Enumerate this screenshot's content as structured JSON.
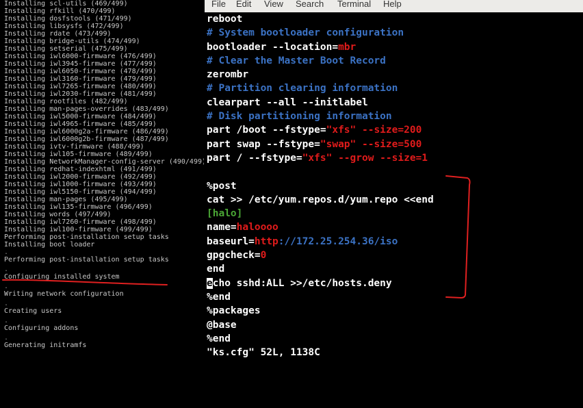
{
  "console": {
    "lines": [
      "Installing scl-utils (469/499)",
      "Installing rfkill (470/499)",
      "Installing dosfstools (471/499)",
      "Installing libsysfs (472/499)",
      "Installing rdate (473/499)",
      "Installing bridge-utils (474/499)",
      "Installing setserial (475/499)",
      "Installing iwl6000-firmware (476/499)",
      "Installing iwl3945-firmware (477/499)",
      "Installing iwl6050-firmware (478/499)",
      "Installing iwl3160-firmware (479/499)",
      "Installing iwl7265-firmware (480/499)",
      "Installing iwl2030-firmware (481/499)",
      "Installing rootfiles (482/499)",
      "Installing man-pages-overrides (483/499)",
      "Installing iwl5000-firmware (484/499)",
      "Installing iwl4965-firmware (485/499)",
      "Installing iwl6000g2a-firmware (486/499)",
      "Installing iwl6000g2b-firmware (487/499)",
      "Installing ivtv-firmware (488/499)",
      "Installing iwl105-firmware (489/499)",
      "Installing NetworkManager-config-server (490/499)",
      "Installing redhat-indexhtml (491/499)",
      "Installing iwl2000-firmware (492/499)",
      "Installing iwl1000-firmware (493/499)",
      "Installing iwl5150-firmware (494/499)",
      "Installing man-pages (495/499)",
      "Installing iwl135-firmware (496/499)",
      "Installing words (497/499)",
      "Installing iwl7260-firmware (498/499)",
      "Installing iwl100-firmware (499/499)",
      "Performing post-installation setup tasks",
      "Installing boot loader"
    ],
    "steps": [
      "Performing post-installation setup tasks",
      "Configuring installed system",
      "Writing network configuration",
      "Creating users",
      "Configuring addons",
      "Generating initramfs"
    ],
    "dot": "."
  },
  "menubar": {
    "file": "File",
    "edit": "Edit",
    "view": "View",
    "search": "Search",
    "terminal": "Terminal",
    "help": "Help"
  },
  "terminal": {
    "l1": "reboot",
    "l2": "# System bootloader configuration",
    "l3a": "bootloader --location=",
    "l3b": "mbr",
    "l4": "# Clear the Master Boot Record",
    "l5": "zerombr",
    "l6": "# Partition clearing information",
    "l7": "clearpart --all --initlabel",
    "l8": "# Disk partitioning information",
    "l9a": "part /boot --fstype=",
    "l9b": "\"xfs\"",
    "l9c": " --size=200",
    "l10a": "part swap --fstype=",
    "l10b": "\"swap\"",
    "l10c": " --size=500",
    "l11a": "part / --fstype=",
    "l11b": "\"xfs\"",
    "l11c": " --grow --size=1",
    "l13": "%post",
    "l14": "cat >> /etc/yum.repos.d/yum.repo <<end",
    "l15": "[halo]",
    "l16a": "name=",
    "l16b": "haloooo",
    "l17a": "baseurl=",
    "l17b": "http",
    "l17c": "://172.25.254.36/iso",
    "l18a": "gpgcheck=",
    "l18b": "0",
    "l19": "end",
    "l20a": "e",
    "l20b": "cho sshd:ALL >>/etc/hosts.deny",
    "l21": "%end",
    "l22": "%packages",
    "l23": "@base",
    "l24": "%end",
    "status": "\"ks.cfg\" 52L, 1138C"
  },
  "colors": {
    "comment": "#3b72c4",
    "string": "#e01b1b",
    "section": "#4aa635",
    "annotation": "#e02020"
  }
}
